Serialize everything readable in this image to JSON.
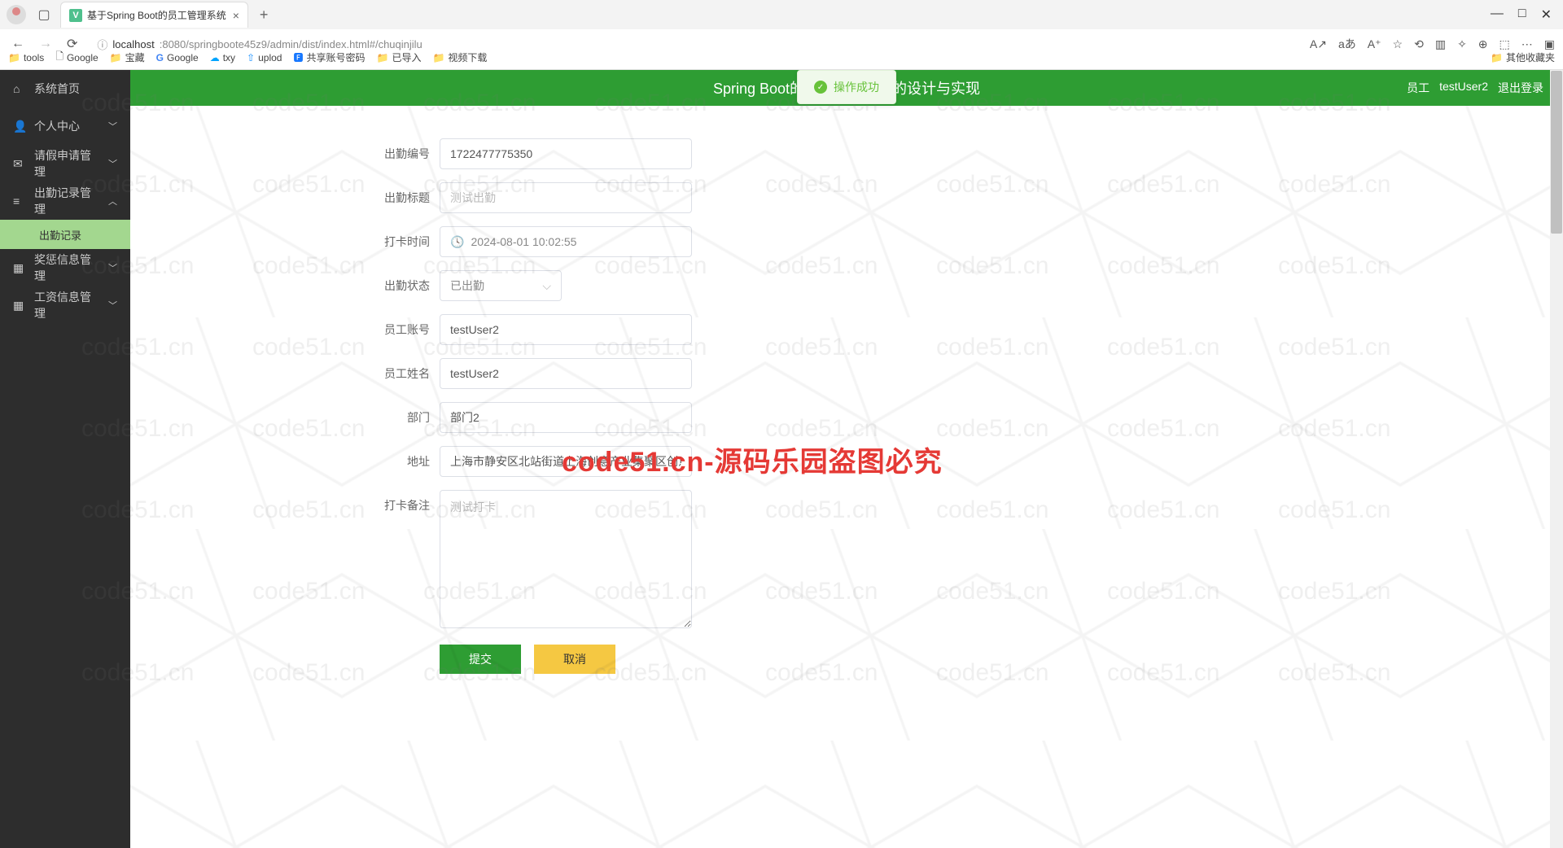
{
  "browser": {
    "tab_title": "基于Spring Boot的员工管理系统",
    "url_host": "localhost",
    "url_path": ":8080/springboote45z9/admin/dist/index.html#/chuqinjilu",
    "bookmarks": [
      "tools",
      "Google",
      "宝藏",
      "Google",
      "txy",
      "uplod",
      "共享账号密码",
      "已导入",
      "视频下载"
    ],
    "bookmarks_other": "其他收藏夹",
    "win_min": "—",
    "win_max": "□",
    "win_close": "✕"
  },
  "toast": {
    "text": "操作成功"
  },
  "header": {
    "title": "Spring Boot的员工管理系统的设计与实现",
    "role": "员工",
    "user": "testUser2",
    "logout": "退出登录"
  },
  "sidebar": {
    "items": [
      {
        "icon": "⌂",
        "label": "系统首页",
        "arrow": ""
      },
      {
        "icon": "👤",
        "label": "个人中心",
        "arrow": "﹀"
      },
      {
        "icon": "✉",
        "label": "请假申请管理",
        "arrow": "﹀"
      },
      {
        "icon": "≡",
        "label": "出勤记录管理",
        "arrow": "︿"
      },
      {
        "icon": "▦",
        "label": "奖惩信息管理",
        "arrow": "﹀"
      },
      {
        "icon": "▦",
        "label": "工资信息管理",
        "arrow": "﹀"
      }
    ],
    "submenu": "出勤记录"
  },
  "form": {
    "fields": {
      "attendance_no": {
        "label": "出勤编号",
        "value": "1722477775350"
      },
      "title": {
        "label": "出勤标题",
        "placeholder": "测试出勤"
      },
      "clock_time": {
        "label": "打卡时间",
        "value": "2024-08-01 10:02:55"
      },
      "status": {
        "label": "出勤状态",
        "value": "已出勤"
      },
      "account": {
        "label": "员工账号",
        "value": "testUser2"
      },
      "name": {
        "label": "员工姓名",
        "value": "testUser2"
      },
      "dept": {
        "label": "部门",
        "value": "部门2"
      },
      "address": {
        "label": "地址",
        "value": "上海市静安区北站街道上海创意产业集聚区创意仓库"
      },
      "remark": {
        "label": "打卡备注",
        "placeholder": "测试打卡"
      }
    },
    "submit": "提交",
    "cancel": "取消"
  },
  "watermark": {
    "text": "code51.cn",
    "main": "code51.cn-源码乐园盗图必究"
  }
}
